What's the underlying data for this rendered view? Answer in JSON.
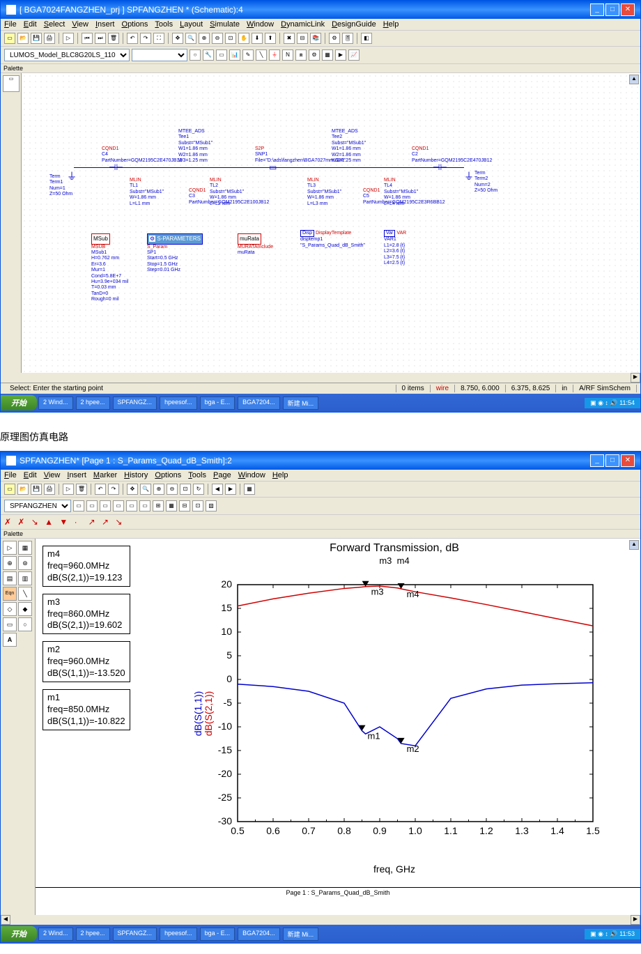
{
  "window1": {
    "title": "[ BGA7024FANGZHEN_prj ] SPFANGZHEN * (Schematic):4",
    "menus": [
      "File",
      "Edit",
      "Select",
      "View",
      "Insert",
      "Options",
      "Tools",
      "Layout",
      "Simulate",
      "Window",
      "DynamicLink",
      "DesignGuide",
      "Help"
    ],
    "component_selector": "LUMOS_Model_BLC8G20LS_110",
    "palette_label": "Palette",
    "components": {
      "term1": {
        "name": "Term",
        "inst": "Term1",
        "num": "Num=1",
        "z": "Z=50 Ohm"
      },
      "term2": {
        "name": "Term",
        "inst": "Term2",
        "num": "Num=2",
        "z": "Z=50 Ohm"
      },
      "c4": {
        "type": "CQND1",
        "name": "C4",
        "part": "PartNumber=GQM2195C2E470JB12"
      },
      "c2": {
        "type": "CQND1",
        "name": "C2",
        "part": "PartNumber=GQM2195C2E470JB12"
      },
      "c3": {
        "type": "CQND1",
        "name": "C3",
        "part": "PartNumber=GQM2195C2E100JB12"
      },
      "c5": {
        "type": "CQND1",
        "name": "C5",
        "part": "PartNumber=GQM2195C2E3R6BB12"
      },
      "mtee1": {
        "name": "MTEE_ADS",
        "inst": "Tee1",
        "subst": "Subst=\"MSub1\"",
        "w1": "W1=1.86 mm",
        "w2": "W2=1.86 mm",
        "w3": "W3=1.25 mm"
      },
      "mtee2": {
        "name": "MTEE_ADS",
        "inst": "Tee2",
        "subst": "Subst=\"MSub1\"",
        "w1": "W1=1.86 mm",
        "w2": "W2=1.86 mm",
        "w3": "W3=1.25 mm"
      },
      "tl1": {
        "name": "MLIN",
        "inst": "TL1",
        "subst": "Subst=\"MSub1\"",
        "w": "W=1.86 mm",
        "l": "L=L1 mm"
      },
      "tl2": {
        "name": "MLIN",
        "inst": "TL2",
        "subst": "Subst=\"MSub1\"",
        "w": "W=1.86 mm",
        "l": "L=L2 mm"
      },
      "tl3": {
        "name": "MLIN",
        "inst": "TL3",
        "subst": "Subst=\"MSub1\"",
        "w": "W=1.86 mm",
        "l": "L=L3 mm"
      },
      "tl4": {
        "name": "MLIN",
        "inst": "TL4",
        "subst": "Subst=\"MSub1\"",
        "w": "W=1.86 mm",
        "l": "L=L4 mm"
      },
      "snp1": {
        "name": "S2P",
        "inst": "SNP1",
        "file": "File=\"D:\\ads\\fangzhen\\BGA7027mm.S2P\""
      },
      "msub": {
        "box": "MSub",
        "name": "MSUB",
        "inst": "MSub1",
        "h": "H=0.762 mm",
        "er": "Er=3.6",
        "mur": "Mur=1",
        "cond": "Cond=5.8E+7",
        "hu": "Hu=3.9e+034 mil",
        "t": "T=0.03 mm",
        "tand": "TanD=0",
        "rough": "Rough=0 mil"
      },
      "sparam": {
        "box": "S-PARAMETERS",
        "name": "S_Param",
        "inst": "SP1",
        "start": "Start=0.5 GHz",
        "stop": "Stop=1.5 GHz",
        "step": "Step=0.01 GHz"
      },
      "murata": {
        "box": "muRata",
        "name": "MURATAInclude",
        "inst": "muRata"
      },
      "disp": {
        "name": "DisplayTemplate",
        "inst": "disptemp1",
        "tpl": "\"S_Params_Quad_dB_Smith\""
      },
      "var": {
        "box": "VAR",
        "name": "VAR",
        "inst": "VAR1",
        "l1": "L1=2.8 {t}",
        "l2": "L2=3.6 {t}",
        "l3": "L3=7.5 {t}",
        "l4": "L4=2.5 {t}"
      }
    },
    "status": {
      "prompt": "Select: Enter the starting point",
      "items": "0 items",
      "mode": "wire",
      "coords1": "8.750, 6.000",
      "coords2": "6.375, 8.625",
      "units": "in",
      "context": "A/RF SimSchem"
    }
  },
  "window2": {
    "title": "SPFANGZHEN* [Page 1 : S_Params_Quad_dB_Smith]:2",
    "menus": [
      "File",
      "Edit",
      "View",
      "Insert",
      "Marker",
      "History",
      "Options",
      "Tools",
      "Page",
      "Window",
      "Help"
    ],
    "page_selector": "SPFANGZHEN",
    "palette_label": "Palette",
    "markers": {
      "m4": {
        "name": "m4",
        "freq": "freq=960.0MHz",
        "val": "dB(S(2,1))=19.123"
      },
      "m3": {
        "name": "m3",
        "freq": "freq=860.0MHz",
        "val": "dB(S(2,1))=19.602"
      },
      "m2": {
        "name": "m2",
        "freq": "freq=960.0MHz",
        "val": "dB(S(1,1))=-13.520"
      },
      "m1": {
        "name": "m1",
        "freq": "freq=850.0MHz",
        "val": "dB(S(1,1))=-10.822"
      }
    },
    "chart": {
      "title": "Forward Transmission, dB",
      "y_label_1": "dB(S(1,1))",
      "y_label_2": "dB(S(2,1))",
      "x_label": "freq, GHz",
      "m1_label": "m1",
      "m2_label": "m2",
      "m3_label": "m3",
      "m4_label": "m4"
    },
    "page_indicator": "Page 1 : S_Params_Quad_dB_Smith"
  },
  "taskbar": {
    "start": "开始",
    "items": [
      "2 Wind...",
      "2 hpee...",
      "SPFANGZ...",
      "hpeesof...",
      "bga - E...",
      "BGA7204...",
      "新建 Mi..."
    ],
    "time1": "11:54",
    "time2": "11:53"
  },
  "caption": "原理图仿真电路",
  "chart_data": {
    "type": "line",
    "title": "Forward Transmission, dB",
    "xlabel": "freq, GHz",
    "ylabel": "dB",
    "xlim": [
      0.5,
      1.5
    ],
    "ylim": [
      -30,
      20
    ],
    "x": [
      0.5,
      0.6,
      0.7,
      0.8,
      0.85,
      0.86,
      0.9,
      0.95,
      0.96,
      1.0,
      1.1,
      1.2,
      1.3,
      1.4,
      1.5
    ],
    "series": [
      {
        "name": "dB(S(2,1))",
        "color": "#C00",
        "values": [
          15.5,
          17.0,
          18.2,
          19.2,
          19.5,
          19.602,
          19.7,
          19.3,
          19.123,
          18.5,
          17.2,
          15.8,
          14.3,
          12.8,
          11.3
        ]
      },
      {
        "name": "dB(S(1,1))",
        "color": "#00C",
        "values": [
          -1.0,
          -1.5,
          -2.5,
          -5.0,
          -10.822,
          -11.5,
          -10.0,
          -12.5,
          -13.52,
          -14.0,
          -4.0,
          -2.0,
          -1.2,
          -0.9,
          -0.7
        ]
      }
    ],
    "markers": [
      {
        "name": "m1",
        "x": 0.85,
        "y": -10.822,
        "series": "dB(S(1,1))"
      },
      {
        "name": "m2",
        "x": 0.96,
        "y": -13.52,
        "series": "dB(S(1,1))"
      },
      {
        "name": "m3",
        "x": 0.86,
        "y": 19.602,
        "series": "dB(S(2,1))"
      },
      {
        "name": "m4",
        "x": 0.96,
        "y": 19.123,
        "series": "dB(S(2,1))"
      }
    ]
  }
}
